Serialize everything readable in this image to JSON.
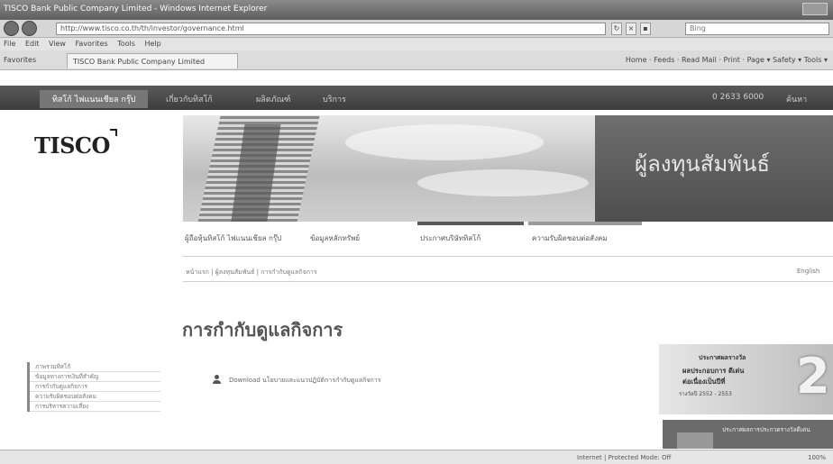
{
  "browser": {
    "window_title": "TISCO Bank Public Company Limited - Windows Internet Explorer",
    "address": "http://www.tisco.co.th/th/investor/governance.html",
    "search_placeholder": "Bing",
    "menu": [
      "File",
      "Edit",
      "View",
      "Favorites",
      "Tools",
      "Help"
    ],
    "favorites_label": "Favorites",
    "tab_title": "TISCO Bank Public Company Limited",
    "command_bar": "Home  ·  Feeds  ·  Read Mail  ·  Print  ·  Page ▾  Safety ▾  Tools ▾",
    "status_zone": "Internet | Protected Mode: Off",
    "zoom": "100%"
  },
  "site_nav": {
    "items": [
      "ทิสโก้ ไฟแนนเชียล กรุ๊ป",
      "เกี่ยวกับทิสโก้",
      "ผลิตภัณฑ์",
      "บริการ"
    ],
    "phone": "0 2633 6000",
    "extra": "ค้นหา"
  },
  "logo": {
    "text": "TISCO"
  },
  "banner": {
    "title": "ผู้ลงทุนสัมพันธ์"
  },
  "sub_nav": {
    "items": [
      "ผู้ถือหุ้นทิสโก้ ไฟแนนเชียล กรุ๊ป",
      "ข้อมูลหลักทรัพย์",
      "ประกาศบริษัททิสโก้",
      "ความรับผิดชอบต่อสังคม"
    ]
  },
  "breadcrumb": "หน้าแรก | ผู้ลงทุนสัมพันธ์ | การกำกับดูแลกิจการ",
  "language": "English",
  "page_title": "การกำกับดูแลกิจการ",
  "download": {
    "text": "Download นโยบายและแนวปฏิบัติการกำกับดูแลกิจการ"
  },
  "side_menu": [
    "ภาพรวมทิสโก้",
    "ข้อมูลทางการเงินที่สำคัญ",
    "การกำกับดูแลกิจการ",
    "ความรับผิดชอบต่อสังคม",
    "การบริหารความเสี่ยง"
  ],
  "promo": {
    "line1": "ประกาศผลรางวัล",
    "line2": "ผลประกอบการ ดีเด่น",
    "line3": "ต่อเนื่องเป็นปีที่",
    "line4": "รางวัลปี 2552 - 2553",
    "big_number": "2",
    "footer_text": "ประกาศผลการประกวดรางวัลดีเด่น"
  }
}
